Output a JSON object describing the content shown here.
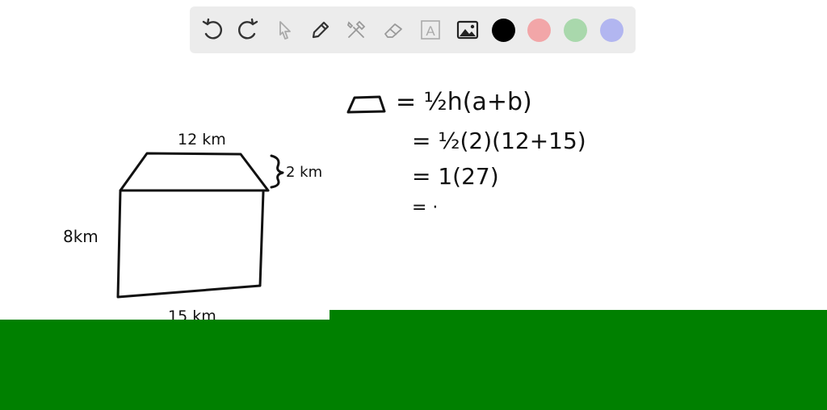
{
  "toolbar": {
    "tools": [
      {
        "name": "undo-icon"
      },
      {
        "name": "redo-icon"
      },
      {
        "name": "pointer-icon"
      },
      {
        "name": "pen-icon"
      },
      {
        "name": "tools-icon"
      },
      {
        "name": "eraser-icon"
      },
      {
        "name": "text-icon",
        "glyph": "A"
      },
      {
        "name": "image-icon"
      }
    ],
    "colors": [
      "#000000",
      "#f2a6a8",
      "#a9d8ac",
      "#b2b6f0"
    ]
  },
  "drawing": {
    "top_label": "12 km",
    "side_height_label": "2 km",
    "left_label": "8km",
    "bottom_label": "15 km",
    "formula_line1": "= ½h(a+b)",
    "formula_line2": "= ½(2)(12+15)",
    "formula_line3": "= 1(27)",
    "formula_line4": "= ·"
  },
  "colors": {
    "overlay_green": "#008000",
    "toolbar_bg": "#ececec"
  }
}
